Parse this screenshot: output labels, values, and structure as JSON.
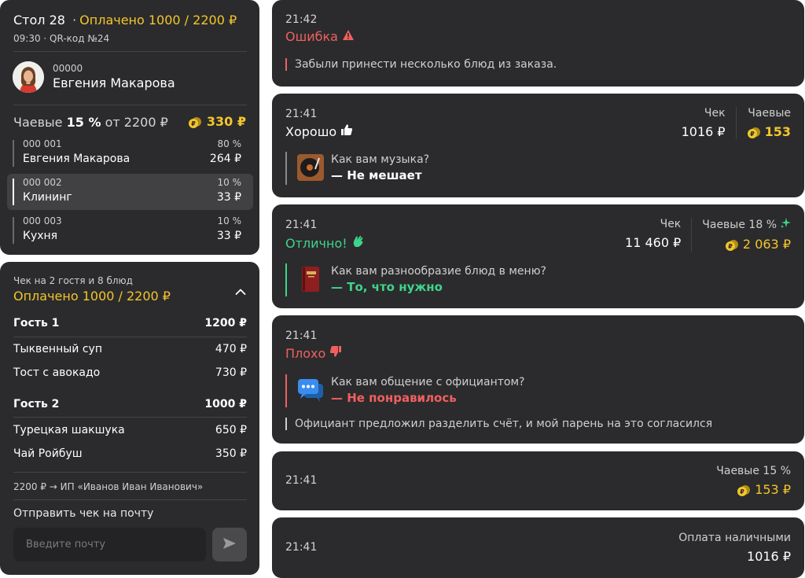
{
  "table_card": {
    "table_label": "Стол",
    "table_number": "28",
    "dot": "·",
    "paid_status": "Оплачено 1000 / 2200 ₽",
    "time_qr": "09:30 · QR-код №24",
    "waiter_code": "00000",
    "waiter_name": "Евгения Макарова",
    "tips_prefix": "Чаевые",
    "tips_pct": "15 %",
    "tips_suffix": "от 2200 ₽",
    "tips_total": "330 ₽",
    "distribution": [
      {
        "code": "000 001",
        "name": "Евгения Макарова",
        "pct": "80 %",
        "amount": "264 ₽"
      },
      {
        "code": "000 002",
        "name": "Клининг",
        "pct": "10 %",
        "amount": "33 ₽"
      },
      {
        "code": "000 003",
        "name": "Кухня",
        "pct": "10 %",
        "amount": "33 ₽"
      }
    ]
  },
  "check_card": {
    "subtitle": "Чек на 2 гостя и 8 блюд",
    "paid_status": "Оплачено 1000 / 2200 ₽",
    "guests": [
      {
        "name": "Гость 1",
        "total": "1200 ₽",
        "items": [
          {
            "name": "Тыквенный суп",
            "price": "470 ₽"
          },
          {
            "name": "Тост с авокадо",
            "price": "730 ₽"
          }
        ]
      },
      {
        "name": "Гость 2",
        "total": "1000 ₽",
        "items": [
          {
            "name": "Турецкая шакшука",
            "price": "650 ₽"
          },
          {
            "name": "Чай Ройбуш",
            "price": "350 ₽"
          }
        ]
      }
    ],
    "transfer": "2200 ₽ → ИП «Иванов Иван Иванович»",
    "send_label": "Отправить чек на почту",
    "email_placeholder": "Введите почту"
  },
  "feed": [
    {
      "time": "21:42",
      "status": "Ошибка",
      "note": "Забыли принести несколько блюд из заказа."
    },
    {
      "time": "21:41",
      "status": "Хорошо",
      "check_label": "Чек",
      "check_value": "1016 ₽",
      "tips_label": "Чаевые",
      "tips_value": "153",
      "question": "Как вам музыка?",
      "answer": "— Не мешает"
    },
    {
      "time": "21:41",
      "status": "Отлично!",
      "check_label": "Чек",
      "check_value": "11 460 ₽",
      "tips_label": "Чаевые 18 %",
      "tips_value": "2 063 ₽",
      "question": "Как вам разнообразие блюд в меню?",
      "answer": "— То, что нужно"
    },
    {
      "time": "21:41",
      "status": "Плохо",
      "question": "Как вам общение с официантом?",
      "answer": "— Не понравилось",
      "note": "Официант предложил разделить счёт, и мой парень на это согласился"
    },
    {
      "time": "21:41",
      "tips_label": "Чаевые 15 %",
      "tips_value": "153 ₽"
    },
    {
      "time": "21:41",
      "pay_label": "Оплата наличными",
      "pay_value": "1016 ₽"
    }
  ],
  "colors": {
    "card_bg": "#2b2b2d",
    "accent_yellow": "#f3c62a",
    "success_green": "#3ed58a",
    "error_red": "#f0605f",
    "neutral_bar": "#8a8a8c"
  },
  "icons": [
    "warning-icon",
    "thumbs-up-icon",
    "clap-icon",
    "thumbs-down-icon",
    "sparkle-icon",
    "coin-icon",
    "vinyl-player-icon",
    "menu-book-icon",
    "chat-bubbles-icon",
    "chevron-up-icon",
    "send-icon"
  ]
}
